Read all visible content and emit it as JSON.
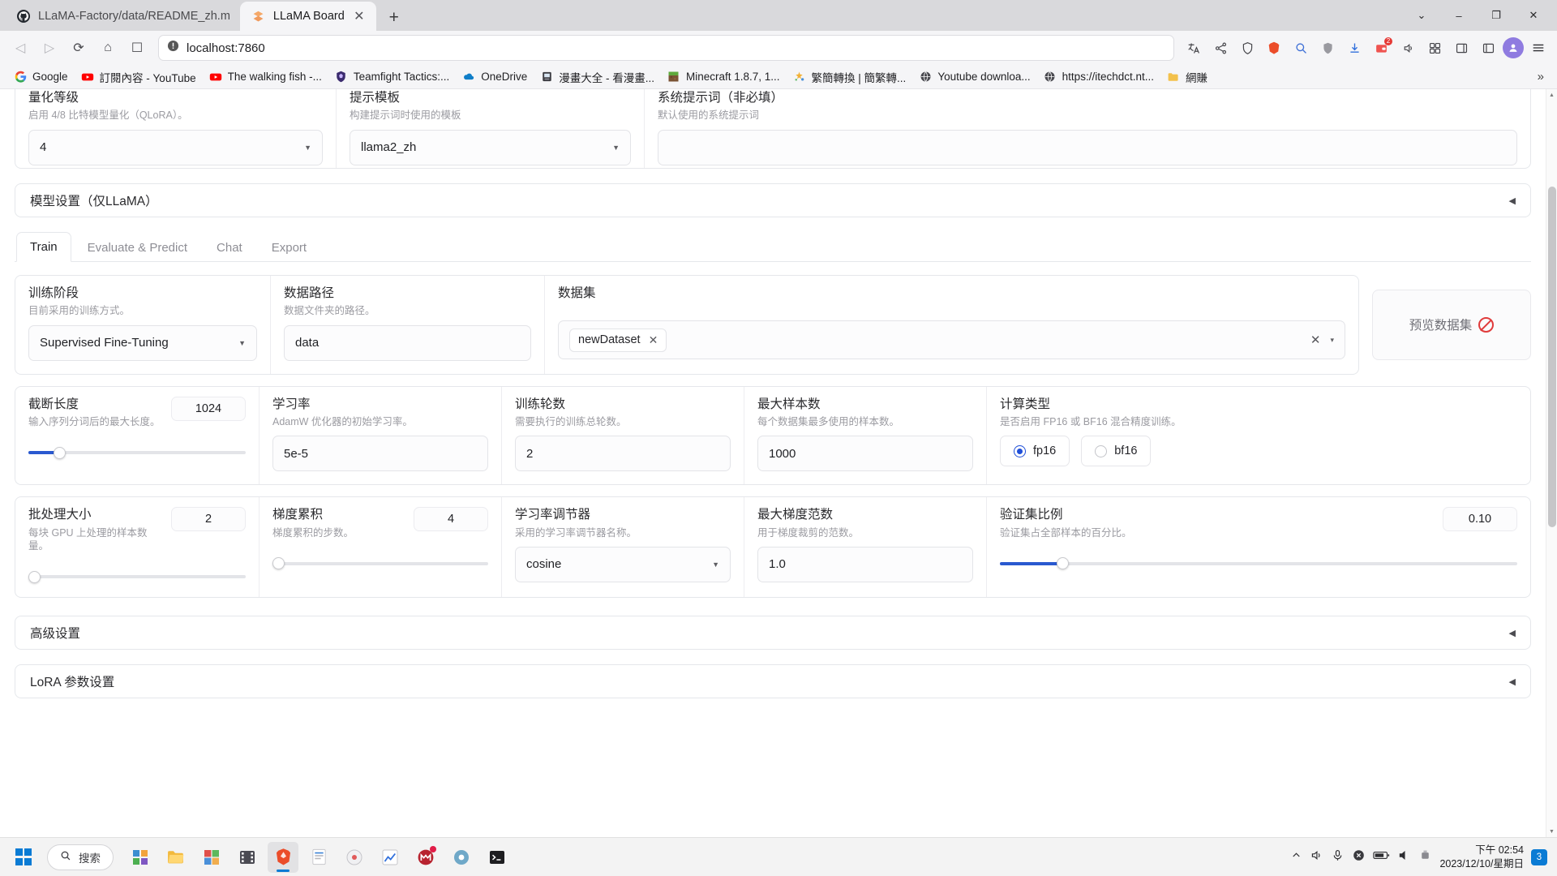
{
  "browser": {
    "tabs": [
      {
        "title": "LLaMA-Factory/data/README_zh.m",
        "icon": "github-icon",
        "active": false
      },
      {
        "title": "LLaMA Board",
        "icon": "llama-icon",
        "active": true
      }
    ],
    "newtab_label": "+",
    "window_controls": {
      "minimize": "–",
      "maximize": "❐",
      "close": "✕",
      "restore": "⌄"
    },
    "nav": {
      "back": "◁",
      "forward": "▷",
      "reload": "⟳",
      "home": "⌂",
      "bookmark": "☐"
    },
    "url": "localhost:7860",
    "url_security_icon": "not-secure-icon",
    "toolbar_icons": [
      "translate-icon",
      "share-icon",
      "shield-icon",
      "brave-icon",
      "search-ext-icon",
      "shield-ext-icon",
      "download-icon",
      "wallet-icon",
      "speaker-icon",
      "grid-icon",
      "sidebar-icon",
      "panel-icon",
      "menu-icon"
    ],
    "ext_badge_count": "2",
    "bookmarks": [
      {
        "label": "Google",
        "icon": "google-icon"
      },
      {
        "label": "訂閱內容 - YouTube",
        "icon": "youtube-icon"
      },
      {
        "label": "The walking fish -...",
        "icon": "youtube-icon"
      },
      {
        "label": "Teamfight Tactics:...",
        "icon": "tft-icon"
      },
      {
        "label": "OneDrive",
        "icon": "onedrive-icon"
      },
      {
        "label": "漫畫大全 - 看漫畫...",
        "icon": "comic-icon"
      },
      {
        "label": "Minecraft 1.8.7, 1...",
        "icon": "minecraft-icon"
      },
      {
        "label": "繁簡轉換 | 簡繁轉...",
        "icon": "convert-icon"
      },
      {
        "label": "Youtube downloa...",
        "icon": "globe-icon"
      },
      {
        "label": "https://itechdct.nt...",
        "icon": "globe-icon"
      },
      {
        "label": "網賺",
        "icon": "folder-icon"
      }
    ],
    "bookmarks_overflow": "»"
  },
  "top_section": {
    "quantization": {
      "label": "量化等级",
      "hint": "启用 4/8 比特模型量化（QLoRA）。",
      "value": "4"
    },
    "template": {
      "label": "提示模板",
      "hint": "构建提示词时使用的模板",
      "value": "llama2_zh"
    },
    "system_prompt": {
      "label": "系统提示词（非必填）",
      "hint": "默认使用的系统提示词",
      "value": ""
    }
  },
  "model_settings_accordion": {
    "label": "模型设置（仅LLaMA）",
    "arrow": "◀"
  },
  "tabs": [
    {
      "label": "Train",
      "active": true
    },
    {
      "label": "Evaluate & Predict",
      "active": false
    },
    {
      "label": "Chat",
      "active": false
    },
    {
      "label": "Export",
      "active": false
    }
  ],
  "train": {
    "stage": {
      "label": "训练阶段",
      "hint": "目前采用的训练方式。",
      "value": "Supervised Fine-Tuning"
    },
    "data_dir": {
      "label": "数据路径",
      "hint": "数据文件夹的路径。",
      "value": "data"
    },
    "dataset": {
      "label": "数据集",
      "tokens": [
        {
          "label": "newDataset",
          "remove": "✕"
        }
      ],
      "clear": "✕",
      "caret": "▾"
    },
    "preview_button": {
      "label": "预览数据集",
      "icon": "no-entry-cursor-icon",
      "disabled": true
    },
    "cutoff_len": {
      "label": "截断长度",
      "hint": "输入序列分词后的最大长度。",
      "value": "1024",
      "slider_percent": 14
    },
    "learning_rate": {
      "label": "学习率",
      "hint": "AdamW 优化器的初始学习率。",
      "value": "5e-5"
    },
    "epochs": {
      "label": "训练轮数",
      "hint": "需要执行的训练总轮数。",
      "value": "2"
    },
    "max_samples": {
      "label": "最大样本数",
      "hint": "每个数据集最多使用的样本数。",
      "value": "1000"
    },
    "compute_type": {
      "label": "计算类型",
      "hint": "是否启用 FP16 或 BF16 混合精度训练。",
      "options": [
        {
          "label": "fp16",
          "selected": true
        },
        {
          "label": "bf16",
          "selected": false
        }
      ]
    },
    "batch_size": {
      "label": "批处理大小",
      "hint": "每块 GPU 上处理的样本数量。",
      "value": "2",
      "slider_percent": 2
    },
    "grad_accum": {
      "label": "梯度累积",
      "hint": "梯度累积的步数。",
      "value": "4",
      "slider_percent": 2
    },
    "lr_scheduler": {
      "label": "学习率调节器",
      "hint": "采用的学习率调节器名称。",
      "value": "cosine"
    },
    "max_grad_norm": {
      "label": "最大梯度范数",
      "hint": "用于梯度裁剪的范数。",
      "value": "1.0"
    },
    "val_size": {
      "label": "验证集比例",
      "hint": "验证集占全部样本的百分比。",
      "value": "0.10",
      "slider_percent": 12
    }
  },
  "bottom_accordions": [
    {
      "label": "高级设置",
      "arrow": "◀"
    },
    {
      "label": "LoRA 参数设置",
      "arrow": "◀"
    }
  ],
  "taskbar": {
    "search_placeholder": "搜索",
    "search_icon": "search-icon",
    "apps": [
      {
        "name": "widgets-icon",
        "active": false
      },
      {
        "name": "file-explorer-icon",
        "active": false
      },
      {
        "name": "store-icon",
        "active": false
      },
      {
        "name": "video-editor-icon",
        "active": false
      },
      {
        "name": "brave-browser-icon",
        "active": true
      },
      {
        "name": "text-editor-icon",
        "active": false
      },
      {
        "name": "disc-icon",
        "active": false
      },
      {
        "name": "chart-app-icon",
        "active": false
      },
      {
        "name": "mendeley-icon",
        "active": false
      },
      {
        "name": "gear-app-icon",
        "active": false
      },
      {
        "name": "terminal-icon",
        "active": false
      }
    ],
    "tray": [
      "chevron-up-icon",
      "volume-icon",
      "mic-icon",
      "close-circle-icon",
      "battery-icon",
      "sound-icon",
      "usb-icon"
    ],
    "clock_time": "下午 02:54",
    "clock_date": "2023/12/10/星期日",
    "notification_count": "3"
  }
}
